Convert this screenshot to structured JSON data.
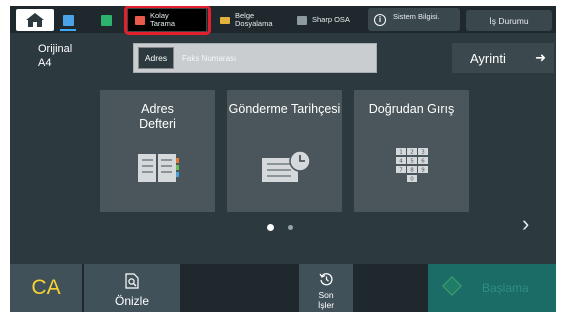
{
  "topbar": {
    "tabs": {
      "kolay": "Kolay\nTarama",
      "belge": "Belge\nDosyalama",
      "sharp": "Sharp OSA"
    },
    "sistem": "Sistem Bilgisi.",
    "is_durumu": "İş Durumu"
  },
  "original": {
    "label": "Orijinal",
    "size": "A4"
  },
  "address": {
    "label": "Adres",
    "placeholder": "Faks Numarası"
  },
  "ayrinti": {
    "label": "Ayrinti"
  },
  "cards": {
    "adres_defteri": "Adres\nDefteri",
    "gonderme": "Gönderme Tarihçesi",
    "dogrudan": "Doğrudan Gırış"
  },
  "keypad": [
    "1",
    "2",
    "3",
    "4",
    "5",
    "6",
    "7",
    "8",
    "9",
    "0"
  ],
  "bottom": {
    "ca": "CA",
    "onizle": "Önizle",
    "son_isler": "Son\nİşler",
    "baslama": "Başlama"
  },
  "colors": {
    "highlight": "#e5202e",
    "ca_text": "#f6d232",
    "start_bg": "#1b6b67"
  }
}
